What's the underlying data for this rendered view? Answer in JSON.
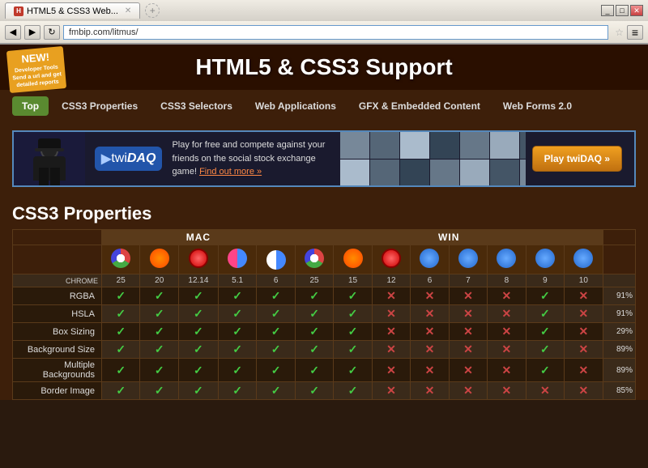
{
  "browser": {
    "title": "HTML5 & CSS3 Web...",
    "url": "fmbip.com/litmus/",
    "tab_label": "HTML5 & CSS3 Web...",
    "back_btn": "◀",
    "forward_btn": "▶",
    "refresh_btn": "↻"
  },
  "page": {
    "new_badge": "NEW! Developer Tools Send a url and get detailed reports",
    "new_text": "NEW!",
    "new_sub": "Developer Tools\nSend a url and get detailed reports",
    "site_title": "HTML5 & CSS3 Support"
  },
  "nav": {
    "tabs": [
      {
        "label": "Top",
        "active": true
      },
      {
        "label": "CSS3 Properties",
        "active": false
      },
      {
        "label": "CSS3 Selectors",
        "active": false
      },
      {
        "label": "Web Applications",
        "active": false
      },
      {
        "label": "GFX & Embedded Content",
        "active": false
      },
      {
        "label": "Web Forms 2.0",
        "active": false
      }
    ]
  },
  "ad": {
    "logo_text": "twi",
    "logo_bold": "DAQ",
    "description": "Play for free and compete against your friends on the social stock exchange game!",
    "find_out": "Find out more »",
    "play_btn": "Play twiDAQ »"
  },
  "table": {
    "section_title": "CSS3 Properties",
    "group_mac": "MAC",
    "group_win": "WIN",
    "browsers_mac": [
      {
        "name": "CHROME",
        "version": "25"
      },
      {
        "name": "FIREFOX",
        "version": "20"
      },
      {
        "name": "OPERA",
        "version": "12.14"
      },
      {
        "name": "SAFARI",
        "version": "5.1"
      },
      {
        "name": "",
        "version": "6"
      }
    ],
    "browsers_win": [
      {
        "name": "CHROME",
        "version": "25"
      },
      {
        "name": "FIREFOX",
        "version": "15"
      },
      {
        "name": "OPERA",
        "version": "12"
      },
      {
        "name": "",
        "version": "6"
      },
      {
        "name": "",
        "version": "7"
      },
      {
        "name": "",
        "version": "8"
      },
      {
        "name": "IE",
        "version": "9"
      },
      {
        "name": "",
        "version": "10"
      }
    ],
    "features": [
      {
        "name": "RGBA",
        "mac": [
          true,
          true,
          true,
          true,
          true
        ],
        "win": [
          true,
          true,
          false,
          false,
          false,
          false,
          true,
          false
        ],
        "pct": "91%"
      },
      {
        "name": "HSLA",
        "mac": [
          true,
          true,
          true,
          true,
          true
        ],
        "win": [
          true,
          true,
          false,
          false,
          false,
          false,
          true,
          false
        ],
        "pct": "91%"
      },
      {
        "name": "Box Sizing",
        "mac": [
          true,
          true,
          true,
          true,
          true
        ],
        "win": [
          true,
          true,
          false,
          false,
          false,
          false,
          true,
          false
        ],
        "pct": "29%"
      },
      {
        "name": "Background Size",
        "mac": [
          true,
          true,
          true,
          true,
          true
        ],
        "win": [
          true,
          true,
          false,
          false,
          false,
          false,
          true,
          false
        ],
        "pct": "89%"
      },
      {
        "name": "Multiple Backgrounds",
        "mac": [
          true,
          true,
          true,
          true,
          true
        ],
        "win": [
          true,
          true,
          false,
          false,
          false,
          false,
          true,
          false
        ],
        "pct": "89%"
      },
      {
        "name": "Border Image",
        "mac": [
          true,
          true,
          true,
          true,
          true
        ],
        "win": [
          true,
          true,
          false,
          false,
          false,
          false,
          false,
          false
        ],
        "pct": "85%"
      }
    ]
  }
}
